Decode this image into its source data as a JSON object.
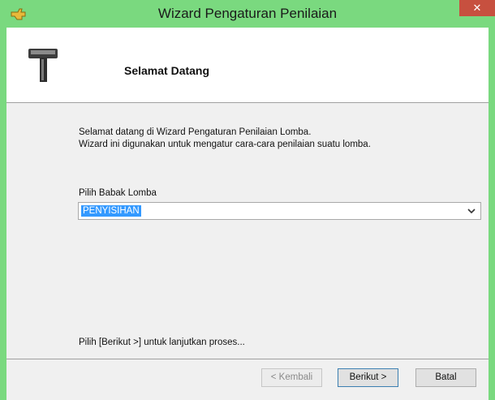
{
  "window": {
    "title": "Wizard Pengaturan Penilaian",
    "close_label": "✕"
  },
  "header": {
    "title": "Selamat Datang"
  },
  "intro": {
    "line1": "Selamat datang di Wizard Pengaturan Penilaian Lomba.",
    "line2": "Wizard ini digunakan untuk mengatur cara-cara penilaian suatu lomba."
  },
  "round_select": {
    "label": "Pilih Babak Lomba",
    "selected": "PENYISIHAN"
  },
  "hint": "Pilih [Berikut >] untuk lanjutkan proses...",
  "buttons": {
    "back": "< Kembali",
    "next": "Berikut >",
    "cancel": "Batal"
  }
}
